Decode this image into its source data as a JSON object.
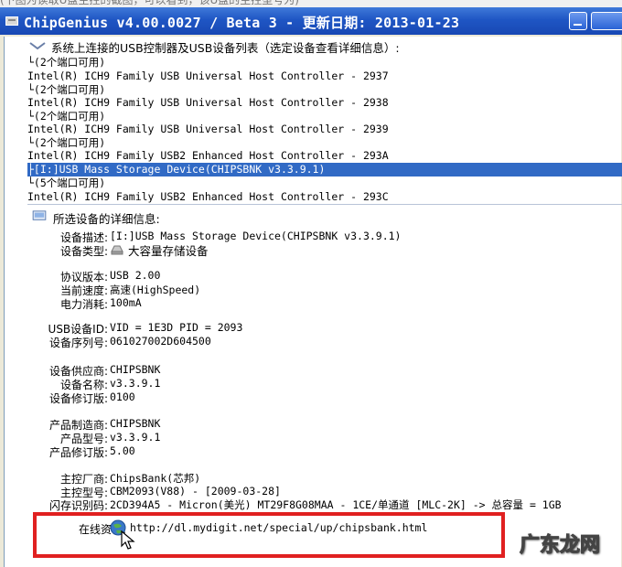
{
  "window": {
    "title": "ChipGenius v4.00.0027 / Beta 3 - 更新日期: 2013-01-23",
    "partial_top_text": "(下图为读取U盘主控的截图，可以看到，该U盘的主控型号为)"
  },
  "device_list": {
    "header": "系统上连接的USB控制器及USB设备列表（选定设备查看详细信息）:",
    "rows": [
      "└(2个端口可用)",
      "Intel(R) ICH9 Family USB Universal Host Controller - 2937",
      "└(2个端口可用)",
      "Intel(R) ICH9 Family USB Universal Host Controller - 2938",
      "└(2个端口可用)",
      "Intel(R) ICH9 Family USB Universal Host Controller - 2939",
      "└(2个端口可用)",
      "Intel(R) ICH9 Family USB2 Enhanced Host Controller - 293A",
      "├[I:]USB Mass Storage Device(CHIPSBNK v3.3.9.1)",
      "└(5个端口可用)",
      "Intel(R) ICH9 Family USB2 Enhanced Host Controller - 293C"
    ],
    "selected_index": 8
  },
  "details": {
    "header": "所选设备的详细信息:",
    "fields": {
      "desc_label": "设备描述:",
      "desc_value": "[I:]USB Mass Storage Device(CHIPSBNK v3.3.9.1)",
      "type_label": "设备类型:",
      "type_value": "大容量存储设备",
      "protocol_label": "协议版本:",
      "protocol_value": "USB 2.00",
      "speed_label": "当前速度:",
      "speed_value": "高速(HighSpeed)",
      "power_label": "电力消耗:",
      "power_value": "100mA",
      "usbid_label": "USB设备ID:",
      "usbid_value": "VID = 1E3D PID = 2093",
      "serial_label": "设备序列号:",
      "serial_value": "061027002D604500",
      "vendor_label": "设备供应商:",
      "vendor_value": "CHIPSBNK",
      "devname_label": "设备名称:",
      "devname_value": "v3.3.9.1",
      "devrev_label": "设备修订版:",
      "devrev_value": "0100",
      "mfr_label": "产品制造商:",
      "mfr_value": "CHIPSBNK",
      "model_label": "产品型号:",
      "model_value": "v3.3.9.1",
      "prodrev_label": "产品修订版:",
      "prodrev_value": "5.00",
      "ctrlvendor_label": "主控厂商:",
      "ctrlvendor_value": "ChipsBank(芯邦)",
      "ctrlmodel_label": "主控型号:",
      "ctrlmodel_value": "CBM2093(V88) - [2009-03-28]",
      "flash_label": "闪存识别码:",
      "flash_value": "2CD394A5 - Micron(美光) MT29F8G08MAA - 1CE/单通道 [MLC-2K] -> 总容量 = 1GB",
      "online_label": "在线资料:",
      "online_value": "http://dl.mydigit.net/special/up/chipsbank.html"
    }
  },
  "watermark": "广东龙网",
  "colors": {
    "highlight": "#e02020",
    "selection": "#316ac5",
    "titlebar": "#2a5fcc"
  }
}
